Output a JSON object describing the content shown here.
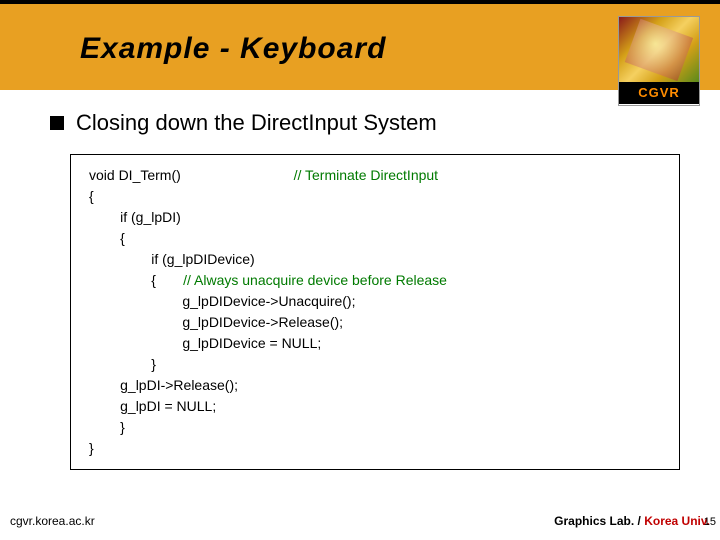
{
  "header": {
    "title": "Example - Keyboard",
    "logo_label": "CGVR"
  },
  "bullet": {
    "text": "Closing down the DirectInput System"
  },
  "code": {
    "l1a": "void DI_Term()",
    "l1b": "                             // Terminate DirectInput",
    "l2": "{",
    "l3": "        if (g_lpDI)",
    "l4": "        {",
    "l5": "                if (g_lpDIDevice)",
    "l6a": "                {       ",
    "l6b": "// Always unacquire device before Release",
    "l7": "                        g_lpDIDevice->Unacquire();",
    "l8": "                        g_lpDIDevice->Release();",
    "l9": "                        g_lpDIDevice = NULL;",
    "l10": "                }",
    "l11": "        g_lpDI->Release();",
    "l12": "        g_lpDI = NULL;",
    "l13": "        }",
    "l14": "}"
  },
  "footer": {
    "left": "cgvr.korea.ac.kr",
    "right1": "Graphics Lab.",
    "sep": " / ",
    "right2": "Korea Univ.",
    "slide_num": "15"
  }
}
